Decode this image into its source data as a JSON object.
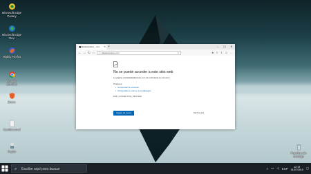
{
  "desktop": {
    "icons": [
      {
        "label": "Microsoft Edge Canary",
        "icon": "edge-canary-icon"
      },
      {
        "label": "Microsoft Edge Dev",
        "icon": "edge-dev-icon"
      },
      {
        "label": "Nightly Firefox",
        "icon": "firefox-icon"
      },
      {
        "label": "Google Chrome",
        "icon": "chrome-icon"
      },
      {
        "label": "Brave",
        "icon": "brave-icon"
      },
      {
        "label": "Cambiar.cmd",
        "icon": "file-icon"
      },
      {
        "label": "Pepito",
        "icon": "pepito-icon"
      }
    ],
    "recycle_bin": {
      "label": "Papelera de reciclaje"
    }
  },
  "browser": {
    "tab": {
      "title": "dataletaisdoso - urru"
    },
    "address": "dataletaisdoso.com",
    "error": {
      "title": "No se puede acceder a este sitio web",
      "description": "La página notdatabataltalnsss.com ha rechazado la conexión.",
      "try_label": "Prueba a:",
      "suggestions": [
        "Comprobar la conexión",
        "Comprobar el proxy y el cortafuegos"
      ],
      "code": "ERR_CONNECTION_REFUSED",
      "reload_label": "Cargar de nuevo",
      "details_label": "DETALLES"
    }
  },
  "taskbar": {
    "search_placeholder": "Escribe aquí para buscar",
    "lang": "ESP",
    "time": "12:19",
    "date": "01/07/2019"
  },
  "colors": {
    "accent": "#0067b8",
    "taskbar": "#1a1f26"
  }
}
